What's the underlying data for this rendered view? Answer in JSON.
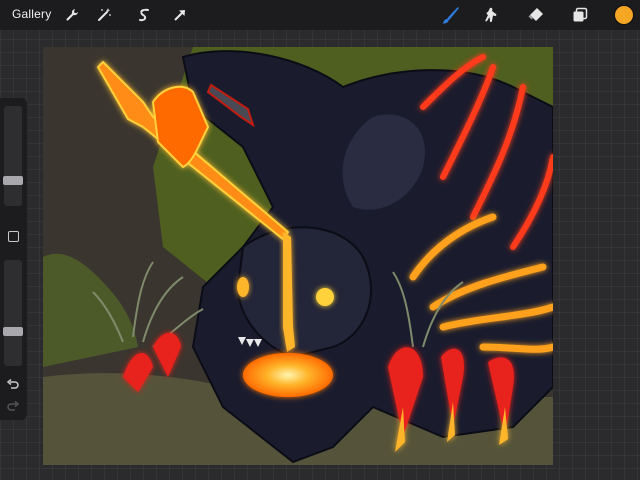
{
  "toolbar": {
    "gallery_label": "Gallery",
    "left_tools": [
      "wrench-icon",
      "magic-wand-icon",
      "selection-icon",
      "transform-arrow-icon"
    ],
    "right_tools": [
      "brush-icon",
      "smudge-icon",
      "eraser-icon",
      "layers-icon"
    ],
    "active_tool": "brush-icon",
    "current_color": "#f5a623",
    "active_color": "#2f7de1"
  },
  "sidebar": {
    "controls": [
      "brush-size-slider",
      "modify-button",
      "opacity-slider",
      "undo-button",
      "redo-button"
    ],
    "brush_size_level": 0.25,
    "opacity_level": 0.27
  },
  "artwork": {
    "subject": "dragon-with-glowing-sword",
    "palette": {
      "background": "#3a352e",
      "foliage": "#4e5f1f",
      "ground": "#55543a",
      "creature": "#1a1c2e",
      "lava": "#ff7a00",
      "glow": "#ffd23a",
      "claw_red": "#e8201a"
    }
  }
}
